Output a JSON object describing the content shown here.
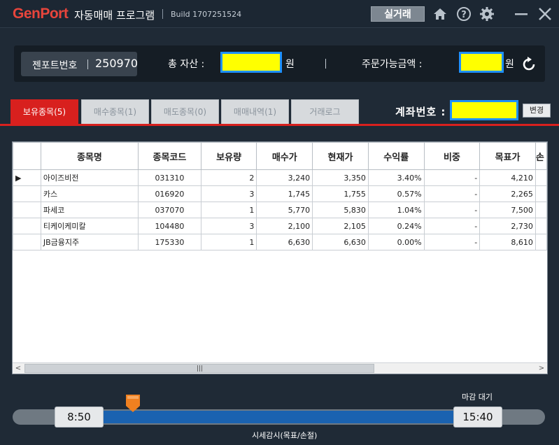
{
  "titlebar": {
    "logo": "GenPort",
    "app_title": "자동매매 프로그램",
    "build": "Build 1707251524",
    "live_button": "실거래",
    "icons": [
      "home-icon",
      "help-icon",
      "gear-icon",
      "minimize-icon",
      "close-icon"
    ]
  },
  "info": {
    "genport_label": "젠포트번호",
    "genport_number": "250970",
    "total_assets_label": "총 자산 :",
    "won": "원",
    "orderable_label": "주문가능금액 :",
    "refresh_icon": "refresh-icon"
  },
  "tabs": [
    {
      "label": "보유종목(5)",
      "active": true
    },
    {
      "label": "매수종목(1)",
      "active": false
    },
    {
      "label": "매도종목(0)",
      "active": false
    },
    {
      "label": "매매내역(1)",
      "active": false
    },
    {
      "label": "거래로그",
      "active": false
    }
  ],
  "account": {
    "label": "계좌번호 :",
    "change_button": "변경"
  },
  "grid": {
    "columns": [
      "종목명",
      "종목코드",
      "보유량",
      "매수가",
      "현재가",
      "수익률",
      "비중",
      "목표가",
      "손"
    ],
    "rows": [
      {
        "name": "아이즈비전",
        "code": "031310",
        "qty": "2",
        "buy": "3,240",
        "cur": "3,350",
        "rate": "3.40%",
        "weight": "-",
        "target": "4,210"
      },
      {
        "name": "카스",
        "code": "016920",
        "qty": "3",
        "buy": "1,745",
        "cur": "1,755",
        "rate": "0.57%",
        "weight": "-",
        "target": "2,265"
      },
      {
        "name": "파세코",
        "code": "037070",
        "qty": "1",
        "buy": "5,770",
        "cur": "5,830",
        "rate": "1.04%",
        "weight": "-",
        "target": "7,500"
      },
      {
        "name": "티케이케미칼",
        "code": "104480",
        "qty": "3",
        "buy": "2,100",
        "cur": "2,105",
        "rate": "0.24%",
        "weight": "-",
        "target": "2,730"
      },
      {
        "name": "JB금융지주",
        "code": "175330",
        "qty": "1",
        "buy": "6,630",
        "cur": "6,630",
        "rate": "0.00%",
        "weight": "-",
        "target": "8,610"
      }
    ]
  },
  "timeline": {
    "start": "8:50",
    "end": "15:40",
    "close_wait": "마감 대기",
    "monitor": "시세감시(목표/손절)"
  },
  "colors": {
    "accent_red": "#d8201e",
    "fill_blue": "#1a62b0",
    "mask_yellow": "#ffff00",
    "mask_border": "#1e90ff"
  }
}
